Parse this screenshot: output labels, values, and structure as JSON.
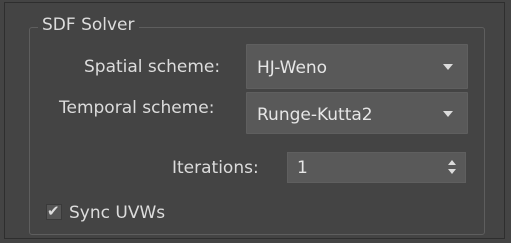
{
  "group": {
    "title": "SDF Solver"
  },
  "spatial_scheme": {
    "label": "Spatial scheme:",
    "selected": "HJ-Weno"
  },
  "temporal_scheme": {
    "label": "Temporal scheme:",
    "selected": "Runge-Kutta2"
  },
  "iterations": {
    "label": "Iterations:",
    "value": "1"
  },
  "sync_uvws": {
    "label": "Sync UVWs",
    "checked": true,
    "check_glyph": "✔"
  }
}
